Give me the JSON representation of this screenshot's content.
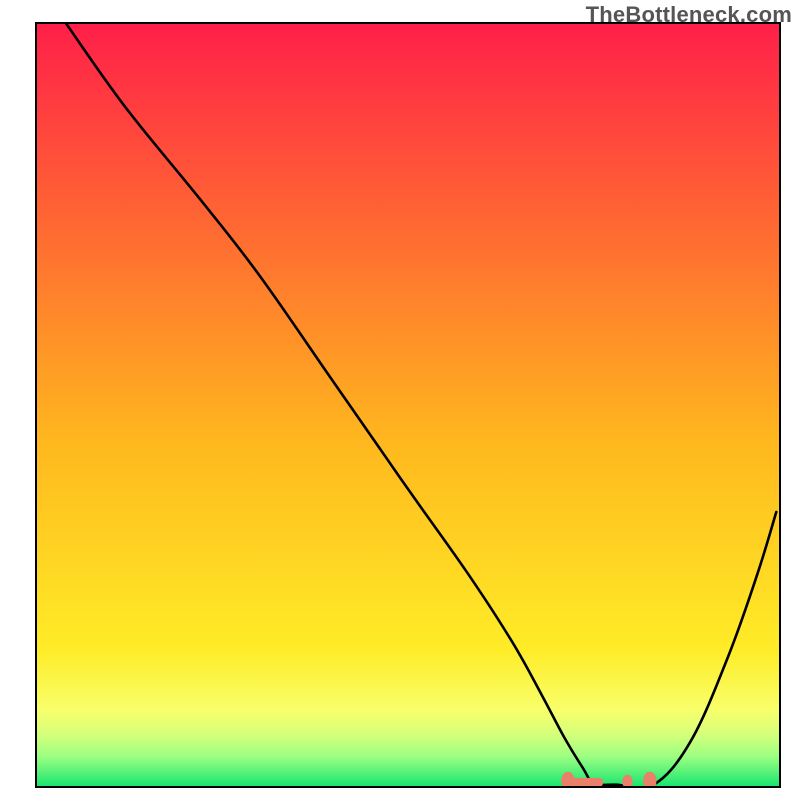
{
  "watermark": {
    "text": "TheBottleneck.com"
  },
  "colors": {
    "gradient_top": "#ff1f49",
    "gradient_upper_mid": "#ff6c31",
    "gradient_mid": "#ffb81e",
    "gradient_lower1": "#ffec27",
    "gradient_lower2": "#f8ff6b",
    "gradient_lower3": "#d6ff7a",
    "gradient_lower4": "#9dff82",
    "gradient_bottom": "#16e56f",
    "frame": "#000000",
    "curve": "#000000",
    "marker": "#e9806a"
  },
  "chart_data": {
    "type": "line",
    "title": "",
    "xlabel": "",
    "ylabel": "",
    "xlim": [
      0,
      100
    ],
    "ylim": [
      0,
      100
    ],
    "grid": false,
    "legend": false,
    "series": [
      {
        "name": "bottleneck-curve",
        "x": [
          4,
          12,
          22,
          30,
          40,
          50,
          58,
          64,
          68,
          71,
          73.5,
          75,
          78,
          83,
          88,
          93,
          97,
          99.5
        ],
        "y": [
          100,
          89,
          77,
          67,
          53,
          39,
          28,
          19,
          12,
          6.5,
          2.5,
          0.5,
          0.3,
          0.3,
          6,
          17,
          28,
          36
        ]
      }
    ],
    "markers": {
      "name": "highlighted-points",
      "color": "#e9806a",
      "points": [
        {
          "shape": "ellipse",
          "x": 71.5,
          "y": 0.8,
          "rx": 0.9,
          "ry": 1.2
        },
        {
          "shape": "rect",
          "x": 74.0,
          "y": 0.6,
          "w": 4.5,
          "h": 1.2
        },
        {
          "shape": "ellipse",
          "x": 79.5,
          "y": 0.7,
          "rx": 0.7,
          "ry": 0.9
        },
        {
          "shape": "ellipse",
          "x": 82.5,
          "y": 0.8,
          "rx": 0.9,
          "ry": 1.2
        }
      ]
    }
  }
}
